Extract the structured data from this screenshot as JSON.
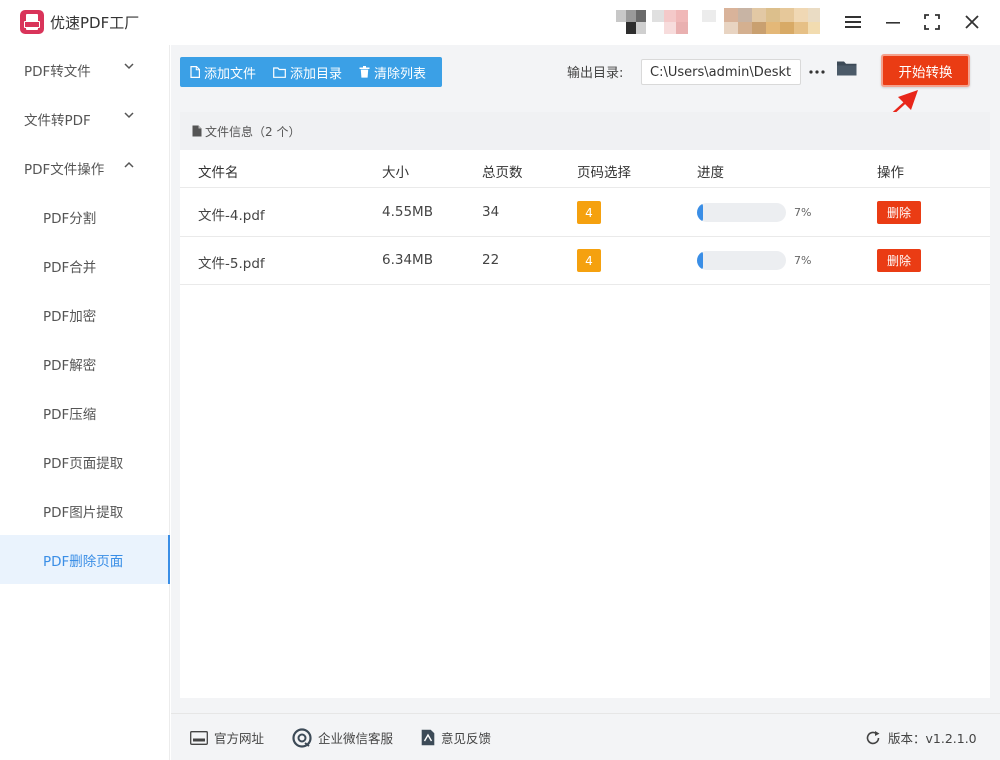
{
  "app": {
    "title": "优速PDF工厂"
  },
  "sidebar": {
    "items": [
      {
        "label": "PDF转文件"
      },
      {
        "label": "文件转PDF"
      },
      {
        "label": "PDF文件操作"
      },
      {
        "label": "PDF分割"
      },
      {
        "label": "PDF合并"
      },
      {
        "label": "PDF加密"
      },
      {
        "label": "PDF解密"
      },
      {
        "label": "PDF压缩"
      },
      {
        "label": "PDF页面提取"
      },
      {
        "label": "PDF图片提取"
      },
      {
        "label": "PDF删除页面"
      }
    ]
  },
  "toolbar": {
    "add_file": "添加文件",
    "add_folder": "添加目录",
    "clear_list": "清除列表"
  },
  "output": {
    "label": "输出目录:",
    "path": "C:\\Users\\admin\\Deskto"
  },
  "start_button": "开始转换",
  "file_panel": {
    "title": "文件信息（2 个）",
    "columns": [
      "文件名",
      "大小",
      "总页数",
      "页码选择",
      "进度",
      "操作"
    ],
    "rows": [
      {
        "name": "文件-4.pdf",
        "size": "4.55MB",
        "pages": "34",
        "page_select": "4",
        "progress": "7%",
        "action": "删除"
      },
      {
        "name": "文件-5.pdf",
        "size": "6.34MB",
        "pages": "22",
        "page_select": "4",
        "progress": "7%",
        "action": "删除"
      }
    ]
  },
  "footer": {
    "website": "官方网址",
    "wechat": "企业微信客服",
    "feedback": "意见反馈",
    "version": "版本：v1.2.1.0"
  },
  "colors": {
    "accent_blue": "#3a8ee6",
    "toolbar_blue": "#3ba0e6",
    "start_red": "#ea3c14",
    "page_select_orange": "#f5a10f",
    "logo_pink": "#d9345a"
  },
  "icons": [
    "pdf-logo-icon",
    "menu-icon",
    "minimize-icon",
    "maximize-icon",
    "close-icon",
    "chevron-down-icon",
    "chevron-up-icon",
    "file-add-icon",
    "folder-icon",
    "trash-icon",
    "more-icon",
    "folder-open-icon",
    "document-icon",
    "website-icon",
    "wechat-icon",
    "feedback-icon",
    "refresh-icon"
  ]
}
